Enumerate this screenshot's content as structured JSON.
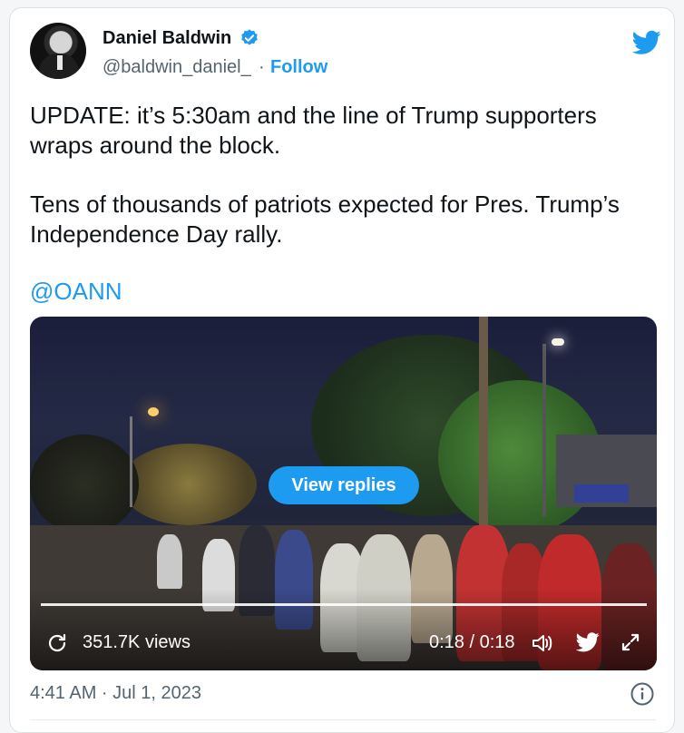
{
  "author": {
    "name": "Daniel Baldwin",
    "handle": "@baldwin_daniel_",
    "separator": "·",
    "follow_label": "Follow"
  },
  "icons": {
    "verified": "verified-badge-icon",
    "logo": "twitter-bird-icon",
    "replay": "replay-icon",
    "volume": "volume-icon",
    "share_bird": "twitter-bird-icon",
    "expand": "expand-icon",
    "info": "info-icon"
  },
  "colors": {
    "accent": "#1d9bf0",
    "text": "#0f1419",
    "muted": "#536471"
  },
  "tweet": {
    "line1": "UPDATE: it’s 5:30am and the line of Trump supporters wraps around the block.",
    "line2": "Tens of thousands of patriots expected for Pres. Trump’s Independence Day rally.",
    "mention": "@OANN"
  },
  "video": {
    "view_replies_label": "View replies",
    "views": "351.7K views",
    "time": "0:18 / 0:18",
    "progress": 1.0
  },
  "footer": {
    "timestamp": "4:41 AM · Jul 1, 2023"
  }
}
